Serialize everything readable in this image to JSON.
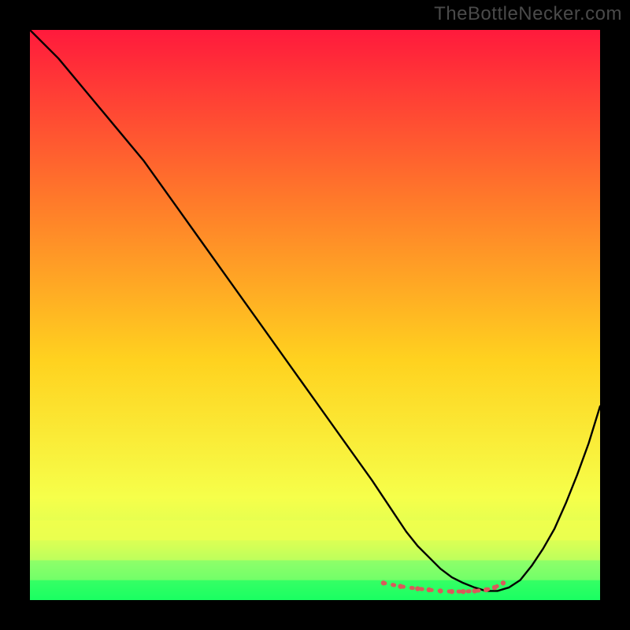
{
  "watermark": "TheBottleNecker.com",
  "colors": {
    "page_bg": "#000000",
    "curve": "#000000",
    "dots": "#d95a5a",
    "grad_top": "#ff1a3c",
    "grad_upper_mid": "#ff7a2a",
    "grad_mid": "#ffd21f",
    "grad_low": "#f6ff4a",
    "grad_band_a": "#d8ff55",
    "grad_band_b": "#86ff6a",
    "grad_bottom": "#1aff63"
  },
  "chart_data": {
    "type": "line",
    "title": "",
    "xlabel": "",
    "ylabel": "",
    "xlim": [
      0,
      100
    ],
    "ylim": [
      0,
      100
    ],
    "annotations": [],
    "series": [
      {
        "name": "bottleneck-curve",
        "x": [
          0,
          5,
          10,
          15,
          20,
          25,
          30,
          35,
          40,
          45,
          50,
          55,
          60,
          62,
          64,
          66,
          68,
          70,
          72,
          74,
          76,
          78,
          80,
          82,
          84,
          86,
          88,
          90,
          92,
          94,
          96,
          98,
          100
        ],
        "values": [
          100,
          95,
          89,
          83,
          77,
          70,
          63,
          56,
          49,
          42,
          35,
          28,
          21,
          18,
          15,
          12,
          9.5,
          7.5,
          5.5,
          4.0,
          3.0,
          2.2,
          1.6,
          1.6,
          2.2,
          3.5,
          6.0,
          9.0,
          12.5,
          17.0,
          22.0,
          27.5,
          34.0
        ]
      }
    ],
    "flat_region": {
      "x": [
        62,
        65,
        68,
        70,
        72,
        74,
        76,
        78,
        80,
        81.5,
        83
      ],
      "values": [
        3.0,
        2.4,
        2.0,
        1.8,
        1.6,
        1.5,
        1.5,
        1.6,
        1.8,
        2.2,
        3.0
      ]
    }
  }
}
